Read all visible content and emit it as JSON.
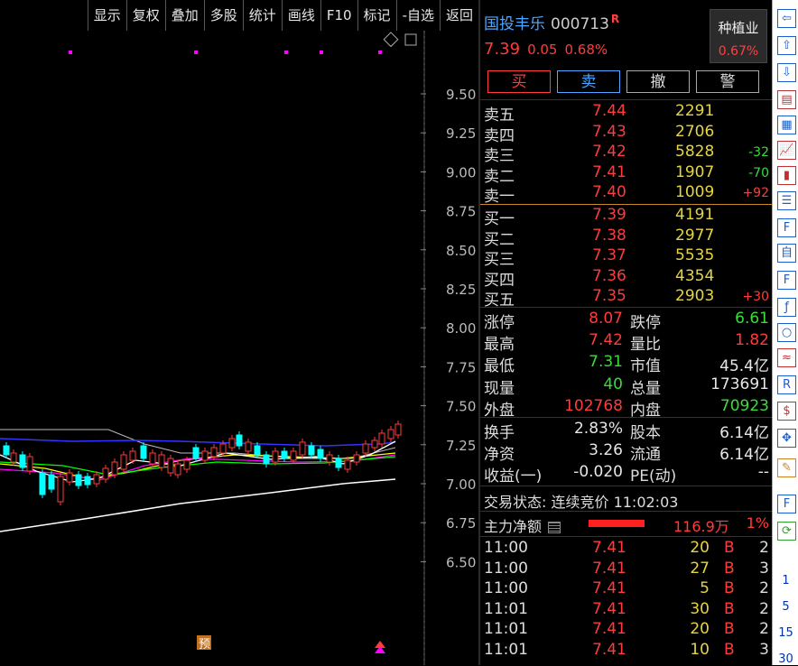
{
  "toolbar": [
    "显示",
    "复权",
    "叠加",
    "多股",
    "统计",
    "画线",
    "F10",
    "标记",
    "-自选",
    "返回"
  ],
  "chart": {
    "price_axis": [
      "9.50",
      "9.25",
      "9.00",
      "8.75",
      "8.50",
      "8.25",
      "8.00",
      "7.75",
      "7.50",
      "7.25",
      "7.00",
      "6.75",
      "6.50"
    ],
    "marker_pre": "预",
    "colors": {
      "up": "#ff3b3b",
      "down": "#00ffff",
      "ma5": "#ffffff",
      "ma10": "#ffff00",
      "ma20": "#ff00ff",
      "ma60": "#00ff00",
      "band": "#3333ff"
    }
  },
  "stock": {
    "name": "国投丰乐",
    "code": "000713",
    "flag": "R",
    "price": "7.39",
    "change": "0.05",
    "pct": "0.68%"
  },
  "sector": {
    "name": "种植业",
    "pct": "0.67%"
  },
  "trade_buttons": {
    "buy": "买",
    "sell": "卖",
    "cancel": "撤",
    "alert": "警"
  },
  "order_book": {
    "asks": [
      {
        "label": "卖五",
        "price": "7.44",
        "vol": "2291",
        "chg": ""
      },
      {
        "label": "卖四",
        "price": "7.43",
        "vol": "2706",
        "chg": ""
      },
      {
        "label": "卖三",
        "price": "7.42",
        "vol": "5828",
        "chg": "-32"
      },
      {
        "label": "卖二",
        "price": "7.41",
        "vol": "1907",
        "chg": "-70"
      },
      {
        "label": "卖一",
        "price": "7.40",
        "vol": "1009",
        "chg": "+92"
      }
    ],
    "bids": [
      {
        "label": "买一",
        "price": "7.39",
        "vol": "4191",
        "chg": ""
      },
      {
        "label": "买二",
        "price": "7.38",
        "vol": "2977",
        "chg": ""
      },
      {
        "label": "买三",
        "price": "7.37",
        "vol": "5535",
        "chg": ""
      },
      {
        "label": "买四",
        "price": "7.36",
        "vol": "4354",
        "chg": ""
      },
      {
        "label": "买五",
        "price": "7.35",
        "vol": "2903",
        "chg": "+30"
      }
    ]
  },
  "stats1": [
    {
      "l1": "涨停",
      "v1": "8.07",
      "c1": "red",
      "l2": "跌停",
      "v2": "6.61",
      "c2": "green"
    },
    {
      "l1": "最高",
      "v1": "7.42",
      "c1": "red",
      "l2": "量比",
      "v2": "1.82",
      "c2": "red"
    },
    {
      "l1": "最低",
      "v1": "7.31",
      "c1": "green",
      "l2": "市值",
      "v2": "45.4亿",
      "c2": "white"
    },
    {
      "l1": "现量",
      "v1": "40",
      "c1": "green",
      "l2": "总量",
      "v2": "173691",
      "c2": "white"
    },
    {
      "l1": "外盘",
      "v1": "102768",
      "c1": "red",
      "l2": "内盘",
      "v2": "70923",
      "c2": "green"
    }
  ],
  "stats2": [
    {
      "l1": "换手",
      "v1": "2.83%",
      "c1": "white",
      "l2": "股本",
      "v2": "6.14亿",
      "c2": "white"
    },
    {
      "l1": "净资",
      "v1": "3.26",
      "c1": "white",
      "l2": "流通",
      "v2": "6.14亿",
      "c2": "white"
    },
    {
      "l1": "收益(一)",
      "v1": "-0.020",
      "c1": "white",
      "l2": "PE(动)",
      "v2": "--",
      "c2": "white"
    }
  ],
  "status": "交易状态: 连续竞价 11:02:03",
  "main_flow": {
    "label": "主力净额",
    "value": "116.9万",
    "pct": "1%"
  },
  "ticks": [
    {
      "time": "11:00",
      "price": "7.41",
      "vol": "20",
      "bs": "B",
      "n": "2"
    },
    {
      "time": "11:00",
      "price": "7.41",
      "vol": "27",
      "bs": "B",
      "n": "3"
    },
    {
      "time": "11:00",
      "price": "7.41",
      "vol": "5",
      "bs": "B",
      "n": "2"
    },
    {
      "time": "11:01",
      "price": "7.41",
      "vol": "30",
      "bs": "B",
      "n": "2"
    },
    {
      "time": "11:01",
      "price": "7.41",
      "vol": "20",
      "bs": "B",
      "n": "2"
    },
    {
      "time": "11:01",
      "price": "7.41",
      "vol": "10",
      "bs": "B",
      "n": "3"
    }
  ],
  "sidebar_numbers": [
    "1",
    "5",
    "15",
    "30"
  ]
}
